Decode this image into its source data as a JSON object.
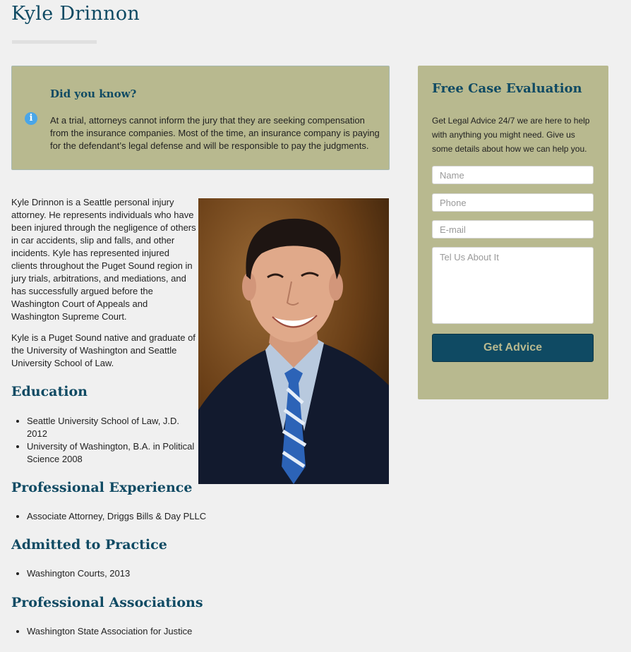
{
  "page": {
    "title": "Kyle Drinnon"
  },
  "did_you_know": {
    "heading": "Did you know?",
    "icon": "info-icon",
    "text": "At a trial, attorneys cannot inform the jury that they are seeking compensation from the insurance companies. Most of the time, an insurance company is paying for the defendant’s legal defense and will be responsible to pay the judgments."
  },
  "bio": {
    "paragraph_1": "Kyle Drinnon is a Seattle personal injury attorney. He represents individuals who have been injured through the negligence of others in car accidents, slip and falls, and other incidents. Kyle has represented injured clients throughout the Puget Sound region in jury trials, arbitrations, and mediations, and has successfully argued before the Washington Court of Appeals and Washington Supreme Court.",
    "paragraph_2": "Kyle is a Puget Sound native and graduate of the University of Washington and Seattle University School of Law."
  },
  "sections": {
    "education": {
      "heading": "Education",
      "items": [
        "Seattle University School of Law, J.D. 2012",
        "University of Washington, B.A. in Political Science 2008"
      ]
    },
    "experience": {
      "heading": "Professional Experience",
      "items": [
        "Associate Attorney, Driggs Bills & Day PLLC"
      ]
    },
    "admitted": {
      "heading": "Admitted to Practice",
      "items": [
        "Washington Courts, 2013"
      ]
    },
    "associations": {
      "heading": "Professional Associations",
      "items": [
        "Washington State Association for Justice"
      ]
    }
  },
  "sidebar": {
    "heading": "Free Case Evaluation",
    "intro": "Get Legal Advice 24/7 we are here to help with anything you might need. Give us some details about how we can help you.",
    "fields": {
      "name_placeholder": "Name",
      "phone_placeholder": "Phone",
      "email_placeholder": "E-mail",
      "message_placeholder": "Tel Us About It"
    },
    "submit_label": "Get Advice"
  },
  "colors": {
    "heading": "#0f4a63",
    "panel": "#b8b98f",
    "button": "#0f4a63",
    "button_text": "#b8b98f",
    "info_icon": "#4aa6e8"
  }
}
